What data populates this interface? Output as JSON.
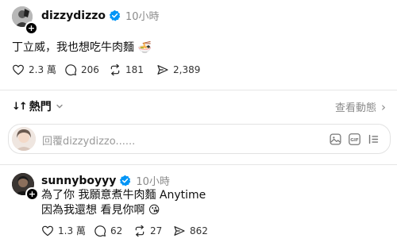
{
  "post": {
    "username": "dizzydizzo",
    "time": "10小時",
    "text": "丁立威，我也想吃牛肉麵 🍜",
    "stats": {
      "likes": "2.3 萬",
      "comments": "206",
      "reposts": "181",
      "shares": "2,389"
    }
  },
  "sort": {
    "arrow": "↓↑",
    "label": "熱門",
    "view_activity": "查看動態",
    "chevron": "›"
  },
  "reply_input": {
    "placeholder": "回覆dizzydizzo......"
  },
  "reply": {
    "username": "sunnyboyyy",
    "time": "10小時",
    "line1": "為了你 我願意煮牛肉麵 Anytime",
    "line2": "因為我還想 看見你啊 😘",
    "stats": {
      "likes": "1.3 萬",
      "comments": "62",
      "reposts": "27",
      "shares": "862"
    }
  }
}
